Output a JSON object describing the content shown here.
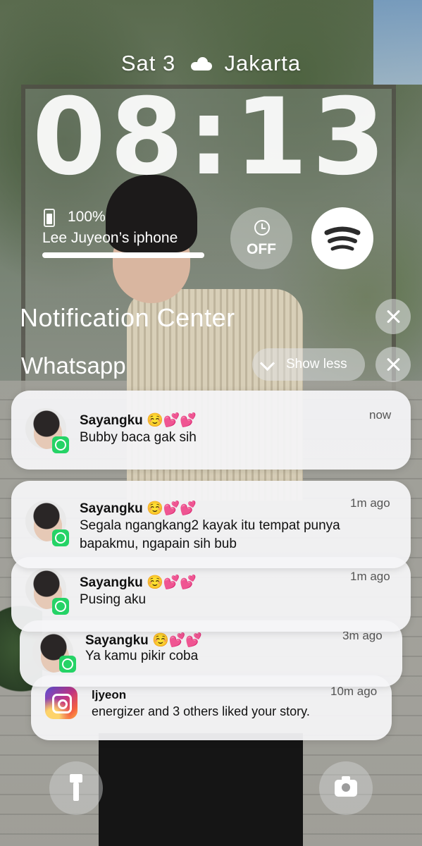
{
  "lockscreen": {
    "day": "Sat 3",
    "weather_icon": "cloud-icon",
    "city": "Jakarta",
    "time": "08:13"
  },
  "widgets": {
    "battery_percent": "100%",
    "battery_level": 1.0,
    "device_name": "Lee Juyeon’s iphone",
    "alarm_label": "OFF",
    "alarm_icon": "alarm-clock-icon",
    "spotify_icon": "spotify-icon"
  },
  "notification_center": {
    "title": "Notification Center",
    "group_app": "Whatsapp",
    "show_less_label": "Show less"
  },
  "notifications": [
    {
      "app": "whatsapp",
      "sender": "Sayangku",
      "hearts": "☺️💕💕",
      "message": "Bubby baca gak sih",
      "time": "now"
    },
    {
      "app": "whatsapp",
      "sender": "Sayangku",
      "hearts": "☺️💕💕",
      "message": "Segala ngangkang2 kayak itu tempat punya bapakmu, ngapain sih bub",
      "time": "1m ago"
    },
    {
      "app": "whatsapp",
      "sender": "Sayangku",
      "hearts": "☺️💕💕",
      "message": "Pusing aku",
      "time": "1m ago"
    },
    {
      "app": "whatsapp",
      "sender": "Sayangku",
      "hearts": "☺️💕💕",
      "message": "Ya kamu pikir coba",
      "time": "3m ago"
    },
    {
      "app": "instagram",
      "sender": "ljyeon",
      "message": "energizer and 3 others liked your story.",
      "time": "10m ago"
    }
  ],
  "bottom": {
    "left_icon": "flashlight-icon",
    "right_icon": "camera-icon"
  },
  "colors": {
    "whatsapp_green": "#25d366",
    "heart_pink": "#e8407d",
    "card_bg": "#f4f4f6"
  }
}
